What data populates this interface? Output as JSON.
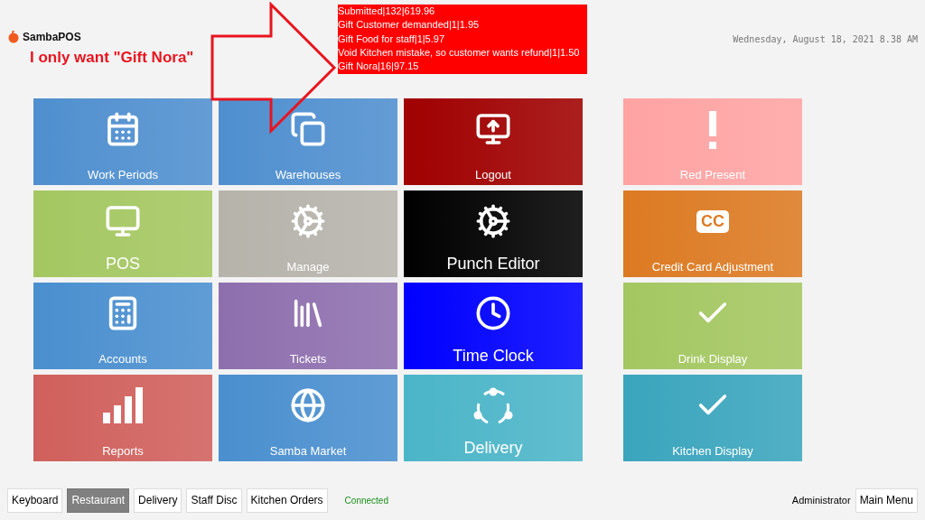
{
  "header": {
    "app_name": "SambaPOS",
    "datetime": "Wednesday, August 18, 2021 8.38 AM"
  },
  "annotation": {
    "note": "I only want \"Gift Nora\"",
    "report_lines": [
      "Submitted|132|619.96",
      "Gift Customer demanded|1|1.95",
      "Gift Food for staff|1|5.97",
      "Void Kitchen mistake, so customer wants refund|1|1.50",
      "Gift Nora|16|97.15"
    ]
  },
  "tile_columns": [
    [
      {
        "label": "Work Periods",
        "color": "#4f8fcf",
        "large": false
      },
      {
        "label": "POS",
        "color": "#a4c761",
        "large": true
      },
      {
        "label": "Accounts",
        "color": "#4a8fcf",
        "large": false
      },
      {
        "label": "Reports",
        "color": "#d0605c",
        "large": false
      }
    ],
    [
      {
        "label": "Warehouses",
        "color": "#4f8fcf",
        "large": false
      },
      {
        "label": "Manage",
        "color": "#b6b3ab",
        "large": false
      },
      {
        "label": "Tickets",
        "color": "#8e6fae",
        "large": false
      },
      {
        "label": "Samba Market",
        "color": "#4a8fcf",
        "large": false
      }
    ],
    [
      {
        "label": "Logout",
        "color": "#a00000",
        "large": false
      },
      {
        "label": "Punch Editor",
        "color": "#000000",
        "large": true
      },
      {
        "label": "Time Clock",
        "color": "#0000ff",
        "large": true
      },
      {
        "label": "Delivery",
        "color": "#4bb5c8",
        "large": true
      }
    ],
    [
      {
        "label": "Red Present",
        "color": "#ffa3a3",
        "large": false
      },
      {
        "label": "Credit Card Adjustment",
        "color": "#dc7a22",
        "large": false,
        "badge": "CC"
      },
      {
        "label": "Drink Display",
        "color": "#a4c761",
        "large": false
      },
      {
        "label": "Kitchen Display",
        "color": "#3aa5bd",
        "large": false
      }
    ]
  ],
  "bottom_bar": {
    "buttons": [
      {
        "label": "Keyboard",
        "selected": false
      },
      {
        "label": "Restaurant",
        "selected": true
      },
      {
        "label": "Delivery",
        "selected": false
      },
      {
        "label": "Staff Disc",
        "selected": false
      },
      {
        "label": "Kitchen Orders",
        "selected": false
      }
    ],
    "status": "Connected",
    "user": "Administrator",
    "main_menu": "Main Menu"
  }
}
